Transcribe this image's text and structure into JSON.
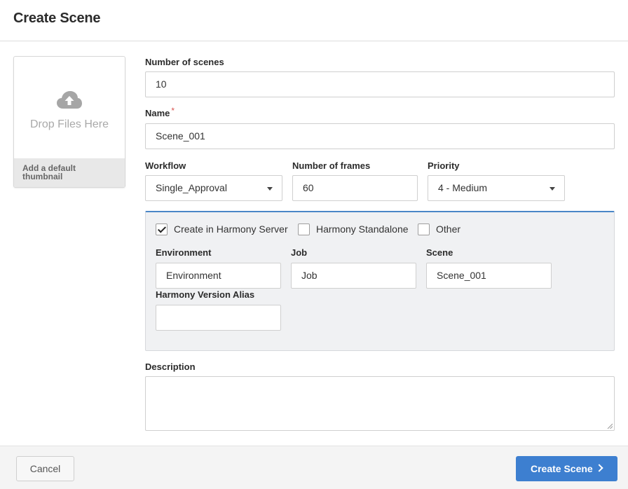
{
  "dialog": {
    "title": "Create Scene"
  },
  "thumbnail": {
    "icon": "cloud-upload-icon",
    "drop_text": "Drop Files Here",
    "default_label": "Add a default thumbnail"
  },
  "fields": {
    "number_of_scenes": {
      "label": "Number of scenes",
      "value": "10"
    },
    "name": {
      "label": "Name",
      "required_mark": "*",
      "value": "Scene_001"
    },
    "workflow": {
      "label": "Workflow",
      "value": "Single_Approval"
    },
    "number_of_frames": {
      "label": "Number of frames",
      "value": "60"
    },
    "priority": {
      "label": "Priority",
      "value": "4 - Medium"
    },
    "description": {
      "label": "Description",
      "value": ""
    }
  },
  "harmony_panel": {
    "options": [
      {
        "label": "Create in Harmony Server",
        "checked": true
      },
      {
        "label": "Harmony Standalone",
        "checked": false
      },
      {
        "label": "Other",
        "checked": false
      }
    ],
    "environment": {
      "label": "Environment",
      "value": "Environment"
    },
    "job": {
      "label": "Job",
      "value": "Job"
    },
    "scene": {
      "label": "Scene",
      "value": "Scene_001"
    },
    "version_alias": {
      "label": "Harmony Version Alias",
      "value": ""
    }
  },
  "footer": {
    "cancel_label": "Cancel",
    "create_label": "Create Scene"
  },
  "colors": {
    "primary": "#3d7fd0",
    "panel_accent": "#4a86c7",
    "required": "#d9534f"
  }
}
